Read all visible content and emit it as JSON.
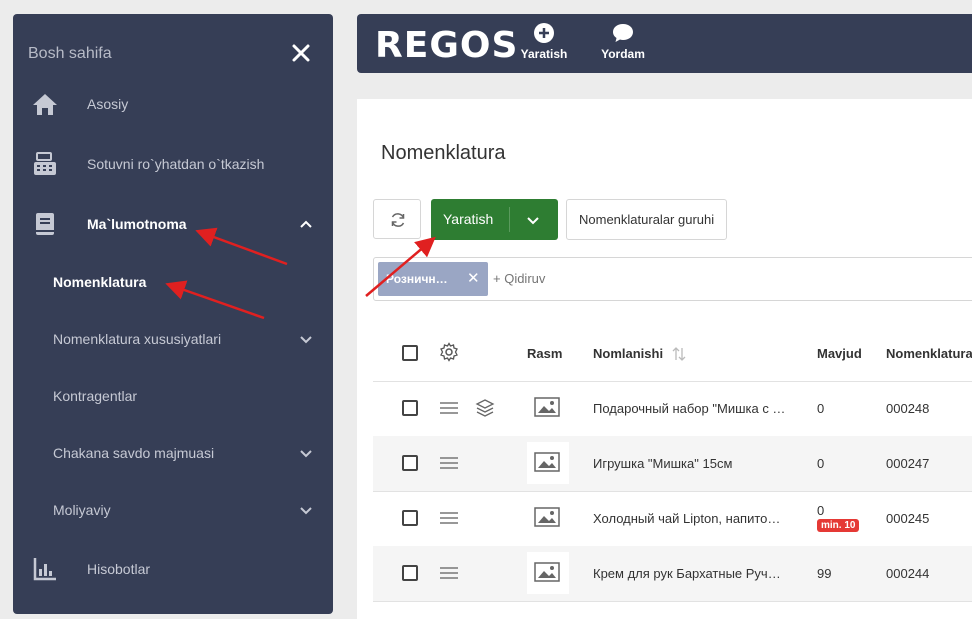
{
  "sidebar": {
    "home_label": "Bosh sahifa",
    "items": [
      {
        "label": "Asosiy",
        "icon": "home-icon"
      },
      {
        "label": "Sotuvni ro`yhatdan o`tkazish",
        "icon": "cash-register-icon"
      },
      {
        "label": "Ma`lumotnoma",
        "icon": "book-icon",
        "expanded": true
      }
    ],
    "subitems": [
      {
        "label": "Nomenklatura",
        "active": true
      },
      {
        "label": "Nomenklatura xususiyatlari",
        "has_children": true
      },
      {
        "label": "Kontragentlar"
      },
      {
        "label": "Chakana savdo majmuasi",
        "has_children": true
      },
      {
        "label": "Moliyaviy",
        "has_children": true
      }
    ],
    "last_item": {
      "label": "Hisobotlar",
      "icon": "chart-icon"
    }
  },
  "topbar": {
    "logo": "REGOS",
    "buttons": [
      {
        "label": "Yaratish",
        "icon": "plus-circle-icon"
      },
      {
        "label": "Yordam",
        "icon": "chat-bubble-icon"
      }
    ]
  },
  "page": {
    "title": "Nomenklatura",
    "create_label": "Yaratish",
    "groups_label": "Nomenklaturalar guruhi",
    "filter_chip": "Розничн…",
    "search_placeholder": "+ Qidiruv"
  },
  "table": {
    "headers": {
      "image": "Rasm",
      "name": "Nomlanishi",
      "stock": "Mavjud",
      "code": "Nomenklatura"
    },
    "rows": [
      {
        "name": "Подарочный набор \"Мишка с …",
        "stock": "0",
        "code": "000248",
        "has_variants": true
      },
      {
        "name": "Игрушка \"Мишка\" 15см",
        "stock": "0",
        "code": "000247"
      },
      {
        "name": "Холодный чай Lipton, напито…",
        "stock": "0",
        "code": "000245",
        "badge": "min. 10"
      },
      {
        "name": "Крем для рук Бархатные Руч…",
        "stock": "99",
        "code": "000244"
      }
    ]
  },
  "colors": {
    "sidebar_bg": "#363e56",
    "create_btn": "#2e7d32",
    "badge": "#e53935",
    "annotation_arrow": "#e02020"
  }
}
